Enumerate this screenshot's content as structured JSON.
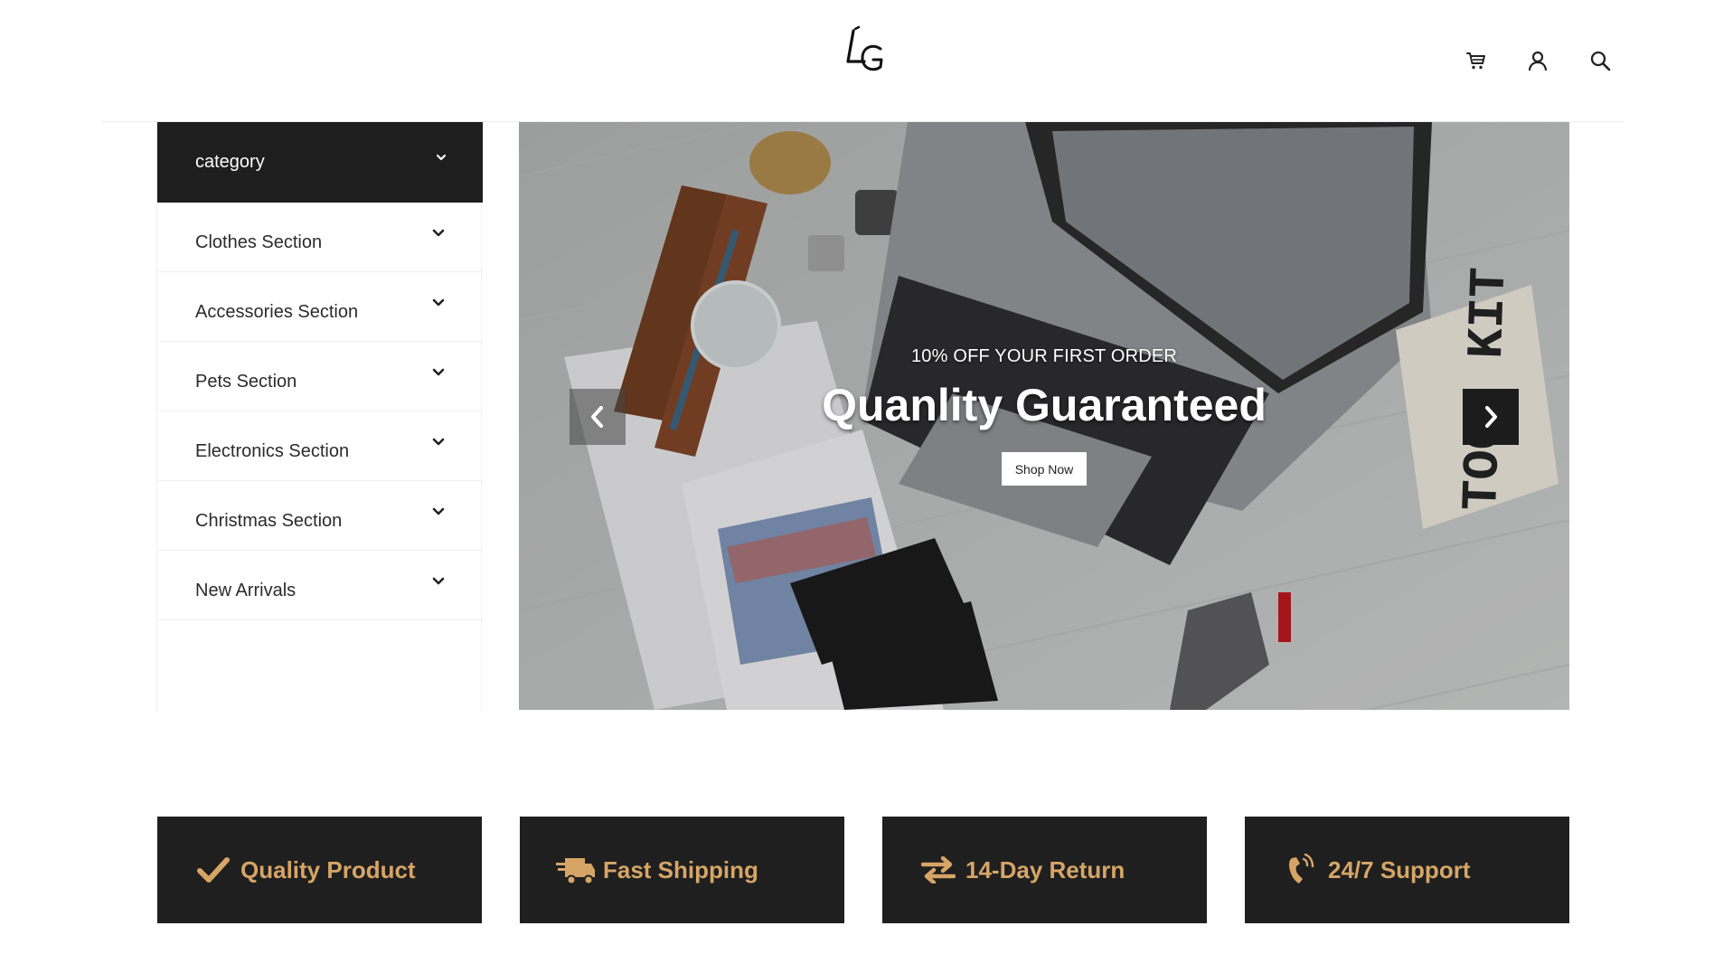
{
  "header": {
    "logo_text": "LG",
    "icons": [
      "cart-icon",
      "user-icon",
      "search-icon"
    ]
  },
  "sidebar": {
    "header_label": "category",
    "items": [
      {
        "label": "Clothes Section"
      },
      {
        "label": "Accessories Section"
      },
      {
        "label": "Pets Section"
      },
      {
        "label": "Electronics Section"
      },
      {
        "label": "Christmas Section"
      },
      {
        "label": "New Arrivals"
      }
    ]
  },
  "hero": {
    "subtitle": "10% OFF YOUR FIRST ORDER",
    "title": "Quanlity Guaranteed",
    "button_label": "Shop Now",
    "pouch_text": "TOOL KIT"
  },
  "features": [
    {
      "label": "Quality Product",
      "icon": "check-icon"
    },
    {
      "label": "Fast Shipping",
      "icon": "truck-icon"
    },
    {
      "label": "14-Day Return",
      "icon": "exchange-icon"
    },
    {
      "label": "24/7 Support",
      "icon": "phone-icon"
    }
  ],
  "colors": {
    "dark": "#1f1f1f",
    "accent_gold": "#d6a566",
    "white": "#ffffff"
  }
}
